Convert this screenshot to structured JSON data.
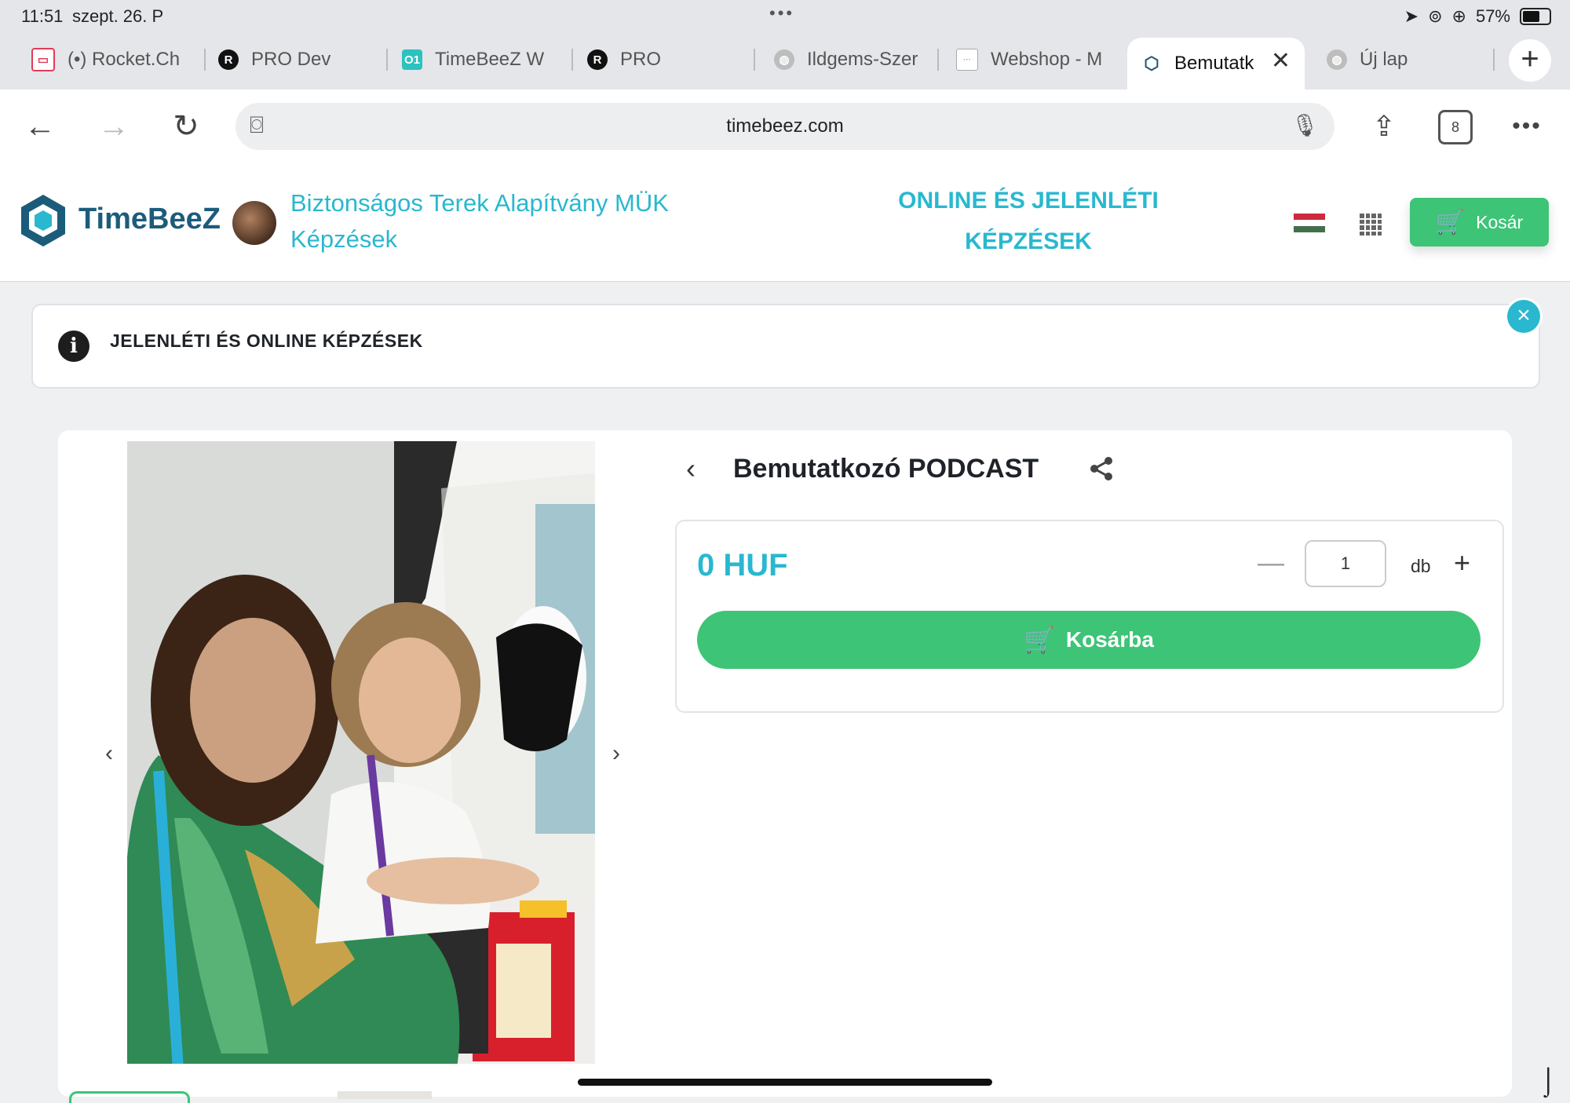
{
  "status_bar": {
    "time": "11:51",
    "date": "szept. 26. P",
    "battery": "57%"
  },
  "tabs": [
    {
      "title": "(•) Rocket.Ch",
      "favicon": "rocket-chat-icon",
      "color": "#e33a5a"
    },
    {
      "title": "PRO Dev",
      "favicon": "R",
      "color": "#111111"
    },
    {
      "title": "TimeBeeZ W",
      "favicon": "O1",
      "color": "#2bc2c0"
    },
    {
      "title": "PRO",
      "favicon": "R",
      "color": "#111111"
    },
    {
      "title": "Ildgems-Szer",
      "favicon": "globe-icon",
      "color": "#9a9a9a"
    },
    {
      "title": "Webshop - M",
      "favicon": "webshop-icon",
      "color": "#bbbbbb"
    },
    {
      "title": "Bemutatk",
      "favicon": "timebeez-icon",
      "color": "#1c5c7a",
      "active": true
    },
    {
      "title": "Új lap",
      "favicon": "globe-icon",
      "color": "#9a9a9a"
    }
  ],
  "toolbar": {
    "url": "timebeez.com",
    "tab_count": "8"
  },
  "header": {
    "logo": "TimeBeeZ",
    "org_title": "Biztonságos Terek Alapítvány MÜK Képzések",
    "nav_label": "ONLINE ÉS JELENLÉTI KÉPZÉSEK",
    "cart_label": "Kosár",
    "language": "hu",
    "accent_color": "#29b8cf",
    "green_color": "#3dc477"
  },
  "notice": {
    "text": "JELENLÉTI ÉS ONLINE KÉPZÉSEK"
  },
  "product": {
    "title": "Bemutatkozó PODCAST",
    "price": "0 HUF",
    "quantity": "1",
    "unit": "db",
    "add_to_cart": "Kosárba"
  }
}
